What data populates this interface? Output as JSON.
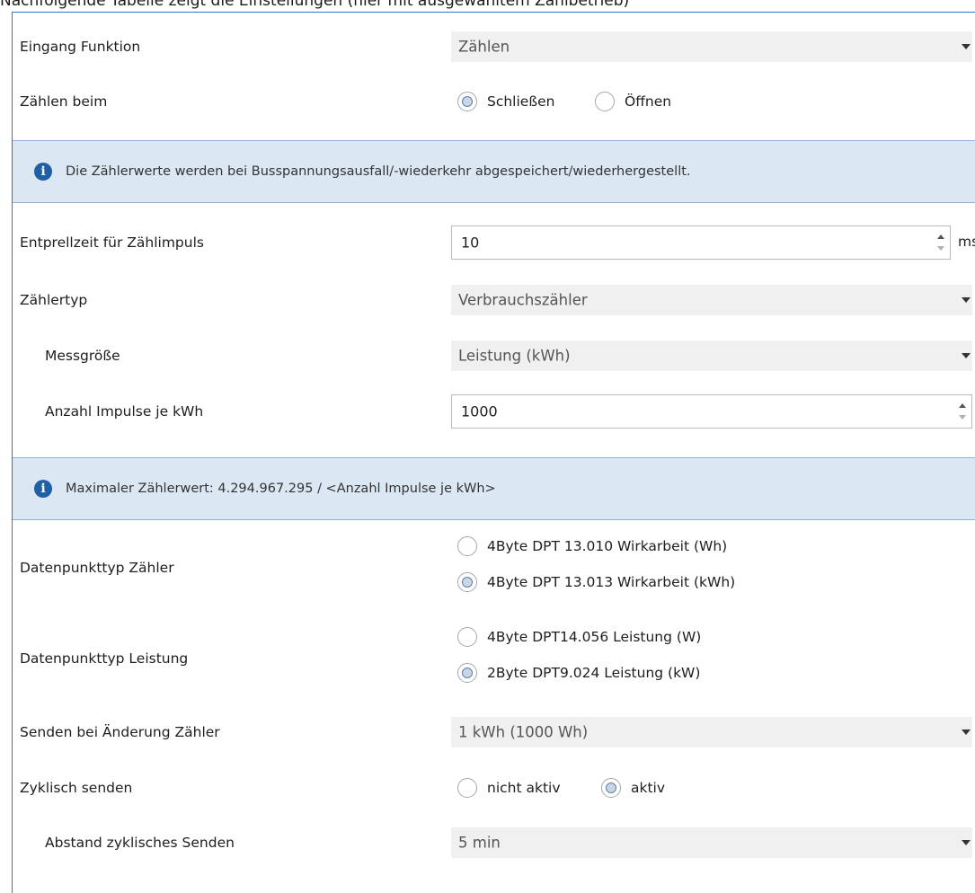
{
  "caption": "Nachfolgende Tabelle zeigt die Einstellungen (hier mit ausgewähltem Zählbetrieb)",
  "eingang_funktion": {
    "label": "Eingang Funktion",
    "value": "Zählen"
  },
  "zaehlen_beim": {
    "label": "Zählen beim",
    "options": [
      "Schließen",
      "Öffnen"
    ],
    "selected": "Schließen"
  },
  "info1": "Die Zählerwerte werden bei Busspannungsausfall/-wiederkehr abgespeichert/wiederhergestellt.",
  "entprellzeit": {
    "label": "Entprellzeit für Zählimpuls",
    "value": "10",
    "unit": "ms"
  },
  "zaehlertyp": {
    "label": "Zählertyp",
    "value": "Verbrauchszähler"
  },
  "messgroesse": {
    "label": "Messgröße",
    "value": "Leistung (kWh)"
  },
  "impulse": {
    "label": "Anzahl Impulse je kWh",
    "value": "1000"
  },
  "info2": "Maximaler Zählerwert: 4.294.967.295 / <Anzahl Impulse je kWh>",
  "dpt_zaehler": {
    "label": "Datenpunkttyp Zähler",
    "options": [
      "4Byte DPT 13.010 Wirkarbeit (Wh)",
      "4Byte DPT 13.013 Wirkarbeit (kWh)"
    ],
    "selected": "4Byte DPT 13.013 Wirkarbeit (kWh)"
  },
  "dpt_leistung": {
    "label": "Datenpunkttyp Leistung",
    "options": [
      "4Byte DPT14.056 Leistung (W)",
      "2Byte DPT9.024 Leistung (kW)"
    ],
    "selected": "2Byte DPT9.024 Leistung (kW)"
  },
  "senden_aenderung": {
    "label": "Senden bei Änderung Zähler",
    "value": "1 kWh (1000 Wh)"
  },
  "zyklisch": {
    "label": "Zyklisch senden",
    "options": [
      "nicht aktiv",
      "aktiv"
    ],
    "selected": "aktiv"
  },
  "abstand": {
    "label": "Abstand zyklisches Senden",
    "value": "5 min"
  }
}
